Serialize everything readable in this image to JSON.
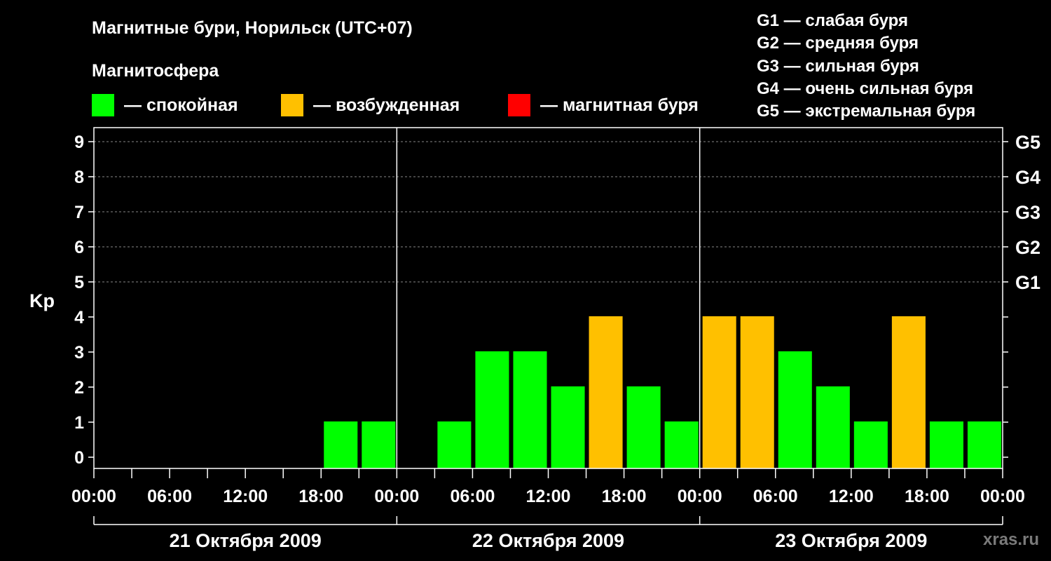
{
  "header": {
    "title": "Магнитные бури, Норильск (UTC+07)",
    "subtitle": "Магнитосфера"
  },
  "legend": [
    {
      "color": "#00ff00",
      "label": "— спокойная"
    },
    {
      "color": "#ffc000",
      "label": "— возбужденная"
    },
    {
      "color": "#ff0000",
      "label": "— магнитная буря"
    }
  ],
  "g_scale_legend": [
    "G1 — слабая буря",
    "G2 — средняя буря",
    "G3 — сильная буря",
    "G4 — очень сильная буря",
    "G5 — экстремальная буря"
  ],
  "watermark": "xras.ru",
  "chart_data": {
    "type": "bar",
    "ylabel": "Kp",
    "ylim": [
      0,
      9
    ],
    "y_ticks": [
      "0",
      "1",
      "2",
      "3",
      "4",
      "5",
      "6",
      "7",
      "8",
      "9"
    ],
    "right_ticks": [
      {
        "kp": 5,
        "label": "G1"
      },
      {
        "kp": 6,
        "label": "G2"
      },
      {
        "kp": 7,
        "label": "G3"
      },
      {
        "kp": 8,
        "label": "G4"
      },
      {
        "kp": 9,
        "label": "G5"
      }
    ],
    "x_tick_labels": [
      "00:00",
      "06:00",
      "12:00",
      "18:00",
      "00:00",
      "06:00",
      "12:00",
      "18:00",
      "00:00",
      "06:00",
      "12:00",
      "18:00",
      "00:00"
    ],
    "days": [
      "21 Октября 2009",
      "22 Октября 2009",
      "23 Октября 2009"
    ],
    "interval_hours": 3,
    "colors": {
      "quiet": "#00ff00",
      "unsettled": "#ffc000",
      "storm": "#ff0000"
    },
    "grid": true,
    "values": [
      null,
      null,
      null,
      null,
      null,
      null,
      1,
      1,
      null,
      1,
      3,
      3,
      2,
      4,
      2,
      1,
      4,
      4,
      3,
      2,
      1,
      4,
      1,
      1
    ]
  }
}
